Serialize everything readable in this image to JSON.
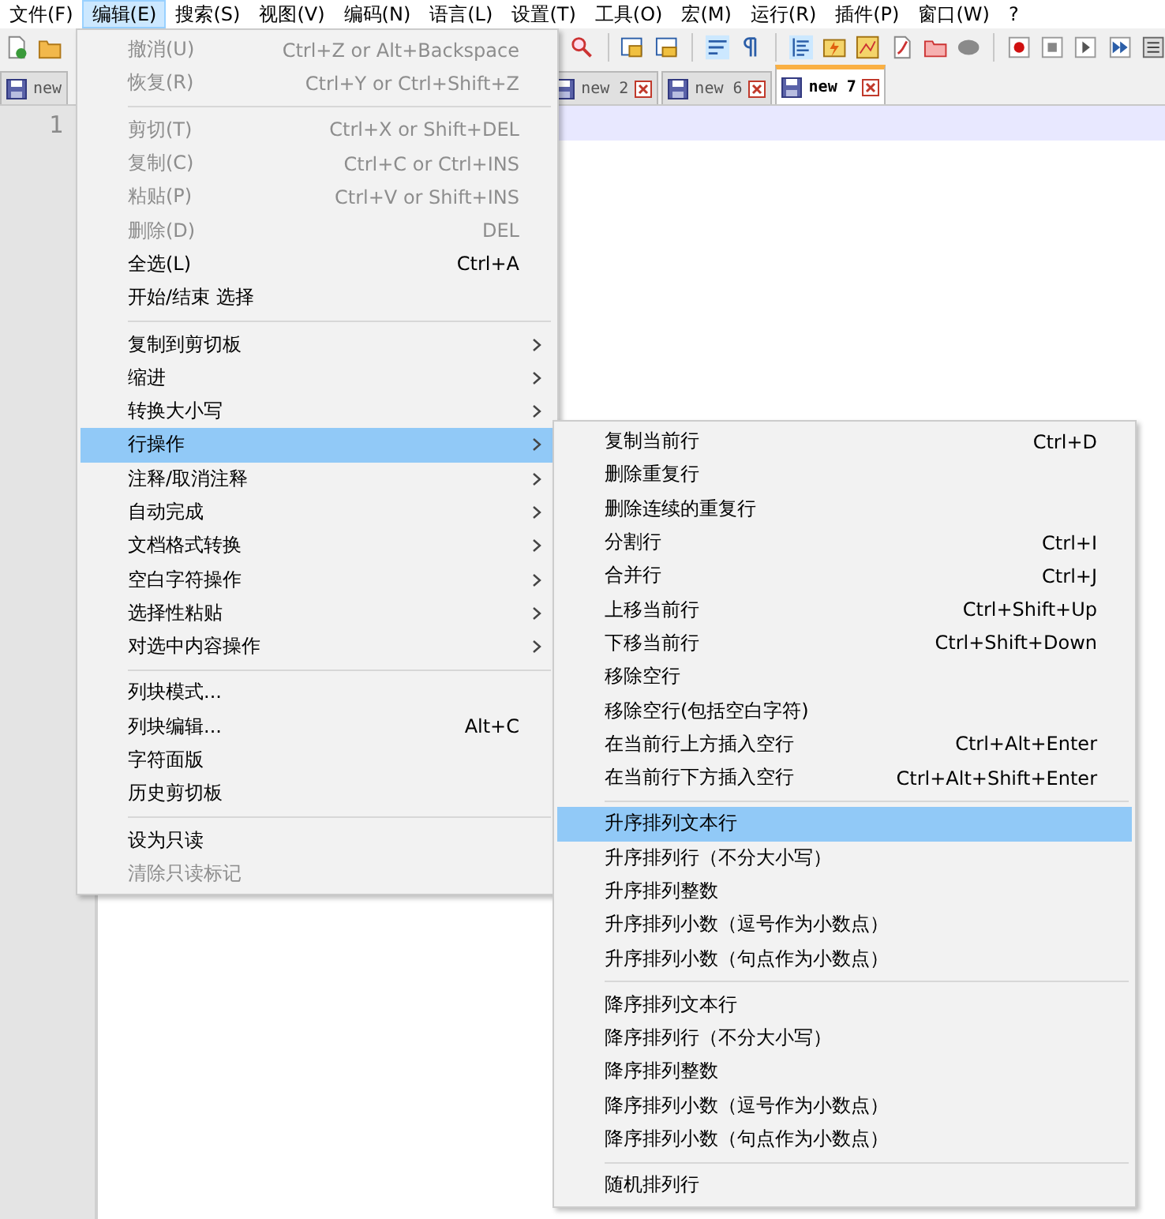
{
  "menubar": [
    {
      "label": "文件(F)",
      "selected": false
    },
    {
      "label": "编辑(E)",
      "selected": true
    },
    {
      "label": "搜索(S)",
      "selected": false
    },
    {
      "label": "视图(V)",
      "selected": false
    },
    {
      "label": "编码(N)",
      "selected": false
    },
    {
      "label": "语言(L)",
      "selected": false
    },
    {
      "label": "设置(T)",
      "selected": false
    },
    {
      "label": "工具(O)",
      "selected": false
    },
    {
      "label": "宏(M)",
      "selected": false
    },
    {
      "label": "运行(R)",
      "selected": false
    },
    {
      "label": "插件(P)",
      "selected": false
    },
    {
      "label": "窗口(W)",
      "selected": false
    },
    {
      "label": "?",
      "selected": false
    }
  ],
  "tabs": [
    {
      "label": "new",
      "selected": false,
      "closable": false
    },
    {
      "label": "new 2",
      "selected": false,
      "closable": true
    },
    {
      "label": "new 6",
      "selected": false,
      "closable": true
    },
    {
      "label": "new 7",
      "selected": true,
      "closable": true
    }
  ],
  "editor": {
    "line_number": "1"
  },
  "edit_menu": [
    {
      "kind": "item",
      "label": "撤消(U)",
      "shortcut": "Ctrl+Z or Alt+Backspace",
      "disabled": true,
      "submenu": false,
      "selected": false
    },
    {
      "kind": "item",
      "label": "恢复(R)",
      "shortcut": "Ctrl+Y or Ctrl+Shift+Z",
      "disabled": true,
      "submenu": false,
      "selected": false
    },
    {
      "kind": "separator"
    },
    {
      "kind": "item",
      "label": "剪切(T)",
      "shortcut": "Ctrl+X or Shift+DEL",
      "disabled": true,
      "submenu": false,
      "selected": false
    },
    {
      "kind": "item",
      "label": "复制(C)",
      "shortcut": "Ctrl+C or Ctrl+INS",
      "disabled": true,
      "submenu": false,
      "selected": false
    },
    {
      "kind": "item",
      "label": "粘贴(P)",
      "shortcut": "Ctrl+V or Shift+INS",
      "disabled": true,
      "submenu": false,
      "selected": false
    },
    {
      "kind": "item",
      "label": "删除(D)",
      "shortcut": "DEL",
      "disabled": true,
      "submenu": false,
      "selected": false
    },
    {
      "kind": "item",
      "label": "全选(L)",
      "shortcut": "Ctrl+A",
      "disabled": false,
      "submenu": false,
      "selected": false
    },
    {
      "kind": "item",
      "label": "开始/结束 选择",
      "disabled": false,
      "submenu": false,
      "selected": false
    },
    {
      "kind": "separator"
    },
    {
      "kind": "item",
      "label": "复制到剪切板",
      "disabled": false,
      "submenu": true,
      "selected": false
    },
    {
      "kind": "item",
      "label": "缩进",
      "disabled": false,
      "submenu": true,
      "selected": false
    },
    {
      "kind": "item",
      "label": "转换大小写",
      "disabled": false,
      "submenu": true,
      "selected": false
    },
    {
      "kind": "item",
      "label": "行操作",
      "disabled": false,
      "submenu": true,
      "selected": true
    },
    {
      "kind": "item",
      "label": "注释/取消注释",
      "disabled": false,
      "submenu": true,
      "selected": false
    },
    {
      "kind": "item",
      "label": "自动完成",
      "disabled": false,
      "submenu": true,
      "selected": false
    },
    {
      "kind": "item",
      "label": "文档格式转换",
      "disabled": false,
      "submenu": true,
      "selected": false
    },
    {
      "kind": "item",
      "label": "空白字符操作",
      "disabled": false,
      "submenu": true,
      "selected": false
    },
    {
      "kind": "item",
      "label": "选择性粘贴",
      "disabled": false,
      "submenu": true,
      "selected": false
    },
    {
      "kind": "item",
      "label": "对选中内容操作",
      "disabled": false,
      "submenu": true,
      "selected": false
    },
    {
      "kind": "separator"
    },
    {
      "kind": "item",
      "label": "列块模式...",
      "disabled": false,
      "submenu": false,
      "selected": false
    },
    {
      "kind": "item",
      "label": "列块编辑...",
      "shortcut": "Alt+C",
      "disabled": false,
      "submenu": false,
      "selected": false
    },
    {
      "kind": "item",
      "label": "字符面版",
      "disabled": false,
      "submenu": false,
      "selected": false
    },
    {
      "kind": "item",
      "label": "历史剪切板",
      "disabled": false,
      "submenu": false,
      "selected": false
    },
    {
      "kind": "separator"
    },
    {
      "kind": "item",
      "label": "设为只读",
      "disabled": false,
      "submenu": false,
      "selected": false
    },
    {
      "kind": "item",
      "label": "清除只读标记",
      "disabled": true,
      "submenu": false,
      "selected": false
    }
  ],
  "line_menu": [
    {
      "kind": "item",
      "label": "复制当前行",
      "shortcut": "Ctrl+D",
      "disabled": false,
      "selected": false
    },
    {
      "kind": "item",
      "label": "删除重复行",
      "disabled": false,
      "selected": false
    },
    {
      "kind": "item",
      "label": "删除连续的重复行",
      "disabled": false,
      "selected": false
    },
    {
      "kind": "item",
      "label": "分割行",
      "shortcut": "Ctrl+I",
      "disabled": false,
      "selected": false
    },
    {
      "kind": "item",
      "label": "合并行",
      "shortcut": "Ctrl+J",
      "disabled": false,
      "selected": false
    },
    {
      "kind": "item",
      "label": "上移当前行",
      "shortcut": "Ctrl+Shift+Up",
      "disabled": false,
      "selected": false
    },
    {
      "kind": "item",
      "label": "下移当前行",
      "shortcut": "Ctrl+Shift+Down",
      "disabled": false,
      "selected": false
    },
    {
      "kind": "item",
      "label": "移除空行",
      "disabled": false,
      "selected": false
    },
    {
      "kind": "item",
      "label": "移除空行(包括空白字符)",
      "disabled": false,
      "selected": false
    },
    {
      "kind": "item",
      "label": "在当前行上方插入空行",
      "shortcut": "Ctrl+Alt+Enter",
      "disabled": false,
      "selected": false
    },
    {
      "kind": "item",
      "label": "在当前行下方插入空行",
      "shortcut": "Ctrl+Alt+Shift+Enter",
      "disabled": false,
      "selected": false
    },
    {
      "kind": "separator"
    },
    {
      "kind": "item",
      "label": "升序排列文本行",
      "disabled": false,
      "selected": true
    },
    {
      "kind": "item",
      "label": "升序排列行（不分大小写）",
      "disabled": false,
      "selected": false
    },
    {
      "kind": "item",
      "label": "升序排列整数",
      "disabled": false,
      "selected": false
    },
    {
      "kind": "item",
      "label": "升序排列小数（逗号作为小数点）",
      "disabled": false,
      "selected": false
    },
    {
      "kind": "item",
      "label": "升序排列小数（句点作为小数点）",
      "disabled": false,
      "selected": false
    },
    {
      "kind": "separator"
    },
    {
      "kind": "item",
      "label": "降序排列文本行",
      "disabled": false,
      "selected": false
    },
    {
      "kind": "item",
      "label": "降序排列行（不分大小写）",
      "disabled": false,
      "selected": false
    },
    {
      "kind": "item",
      "label": "降序排列整数",
      "disabled": false,
      "selected": false
    },
    {
      "kind": "item",
      "label": "降序排列小数（逗号作为小数点）",
      "disabled": false,
      "selected": false
    },
    {
      "kind": "item",
      "label": "降序排列小数（句点作为小数点）",
      "disabled": false,
      "selected": false
    },
    {
      "kind": "separator"
    },
    {
      "kind": "item",
      "label": "随机排列行",
      "disabled": false,
      "selected": false
    }
  ]
}
